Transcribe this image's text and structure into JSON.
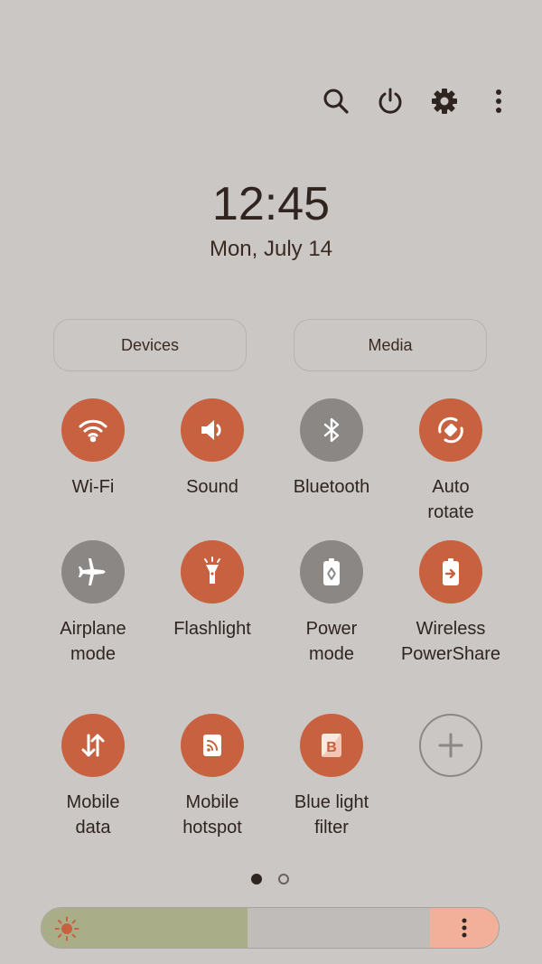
{
  "top_actions": [
    {
      "name": "search-icon"
    },
    {
      "name": "power-icon"
    },
    {
      "name": "settings-gear-icon"
    },
    {
      "name": "more-vertical-icon"
    }
  ],
  "clock": {
    "time": "12:45",
    "date": "Mon, July 14"
  },
  "pills": {
    "devices": "Devices",
    "media": "Media"
  },
  "tiles": [
    {
      "label": "Wi-Fi",
      "icon": "wifi-icon",
      "state": "on"
    },
    {
      "label": "Sound",
      "icon": "speaker-icon",
      "state": "on"
    },
    {
      "label": "Bluetooth",
      "icon": "bluetooth-icon",
      "state": "off"
    },
    {
      "label": "Auto\nrotate",
      "icon": "rotate-icon",
      "state": "on"
    },
    {
      "label": "Airplane\nmode",
      "icon": "airplane-icon",
      "state": "off"
    },
    {
      "label": "Flashlight",
      "icon": "flashlight-icon",
      "state": "on"
    },
    {
      "label": "Power\nmode",
      "icon": "battery-recycle-icon",
      "state": "off"
    },
    {
      "label": "Wireless\nPowerShare",
      "icon": "battery-share-icon",
      "state": "on"
    },
    {
      "label": "Mobile\ndata",
      "icon": "data-arrows-icon",
      "state": "on"
    },
    {
      "label": "Mobile\nhotspot",
      "icon": "hotspot-icon",
      "state": "on"
    },
    {
      "label": "Blue light\nfilter",
      "icon": "blue-light-filter-icon",
      "state": "on"
    },
    {
      "label": "",
      "icon": "add-icon",
      "state": "add"
    }
  ],
  "page_indicator": {
    "pages": 2,
    "current": 1
  },
  "brightness": {
    "level": 0.45
  },
  "colors": {
    "accent": "#c8613f",
    "off": "#8b8784",
    "background": "#cbc7c4",
    "brightness_fill": "#a9ae88",
    "brightness_cap": "#f2b09a"
  }
}
